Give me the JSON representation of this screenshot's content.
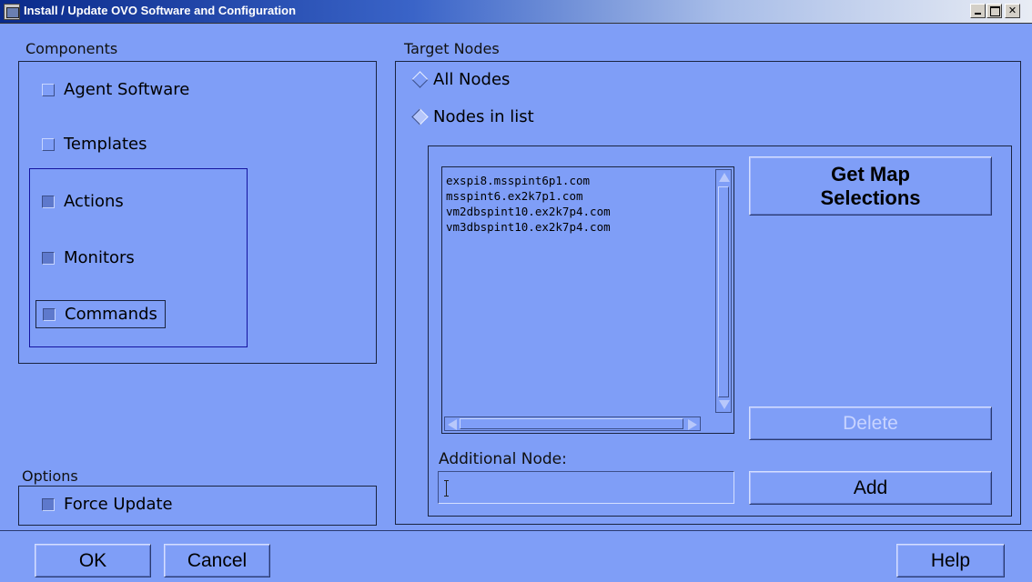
{
  "window": {
    "title": "Install / Update OVO Software and Configuration"
  },
  "components": {
    "label": "Components",
    "items": [
      {
        "label": "Agent Software",
        "checked": false
      },
      {
        "label": "Templates",
        "checked": false
      },
      {
        "label": "Actions",
        "checked": true
      },
      {
        "label": "Monitors",
        "checked": true
      },
      {
        "label": "Commands",
        "checked": true
      }
    ]
  },
  "options": {
    "label": "Options",
    "force_update": {
      "label": "Force Update",
      "checked": true
    }
  },
  "target_nodes": {
    "label": "Target Nodes",
    "radio_all": {
      "label": "All Nodes",
      "selected": false
    },
    "radio_list": {
      "label": "Nodes in list",
      "selected": true
    },
    "nodes": [
      "exspi8.msspint6p1.com",
      "msspint6.ex2k7p1.com",
      "vm2dbspint10.ex2k7p4.com",
      "vm3dbspint10.ex2k7p4.com"
    ],
    "get_map_line1": "Get Map",
    "get_map_line2": "Selections",
    "delete_label": "Delete",
    "additional_label": "Additional Node:",
    "additional_value": "",
    "add_label": "Add"
  },
  "footer": {
    "ok_label": "OK",
    "cancel_label": "Cancel",
    "help_label": "Help"
  },
  "colors": {
    "background": "#7f9ef7",
    "border": "#1a2440",
    "focus_group": "#1414a0"
  }
}
